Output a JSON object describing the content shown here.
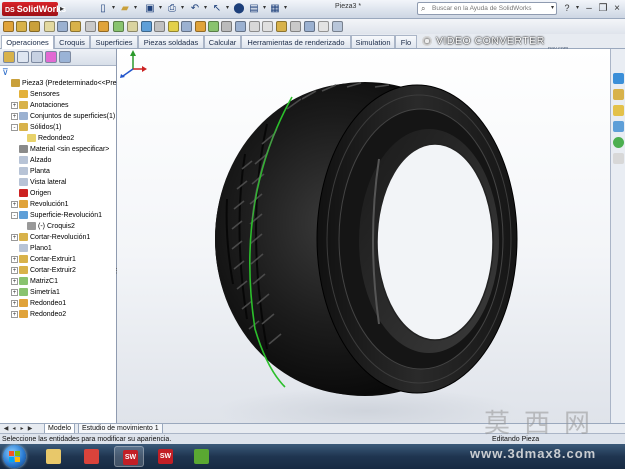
{
  "app": {
    "name": "SolidWorks",
    "doc_title": "Pieza3 *",
    "search_placeholder": "Buscar en la Ayuda de SolidWorks"
  },
  "tabs": [
    {
      "label": "Operaciones",
      "active": true
    },
    {
      "label": "Croquis"
    },
    {
      "label": "Superficies"
    },
    {
      "label": "Piezas soldadas"
    },
    {
      "label": "Calcular"
    },
    {
      "label": "Herramientas de renderizado"
    },
    {
      "label": "Simulation"
    },
    {
      "label": "Flo"
    }
  ],
  "watermark_top": {
    "text": "VIDEO CONVERTER",
    "sub": "pay.com"
  },
  "tree": [
    {
      "label": "Pieza3  (Predeterminado<<Pre",
      "indent": 0,
      "icon": "part-icon",
      "exp": ""
    },
    {
      "label": "Sensores",
      "indent": 1,
      "icon": "sensor-icon",
      "exp": ""
    },
    {
      "label": "Anotaciones",
      "indent": 1,
      "icon": "annotations-icon",
      "exp": "+"
    },
    {
      "label": "Conjuntos de superficies(1)",
      "indent": 1,
      "icon": "surface-bodies-icon",
      "exp": "+"
    },
    {
      "label": "Sólidos(1)",
      "indent": 1,
      "icon": "solid-bodies-icon",
      "exp": "-"
    },
    {
      "label": "Redondeo2",
      "indent": 2,
      "icon": "fillet-body-icon",
      "exp": ""
    },
    {
      "label": "Material <sin especificar>",
      "indent": 1,
      "icon": "material-icon",
      "exp": ""
    },
    {
      "label": "Alzado",
      "indent": 1,
      "icon": "plane-icon",
      "exp": ""
    },
    {
      "label": "Planta",
      "indent": 1,
      "icon": "plane-icon",
      "exp": ""
    },
    {
      "label": "Vista lateral",
      "indent": 1,
      "icon": "plane-icon",
      "exp": ""
    },
    {
      "label": "Origen",
      "indent": 1,
      "icon": "origin-icon",
      "exp": ""
    },
    {
      "label": "Revolución1",
      "indent": 1,
      "icon": "revolve-icon",
      "exp": "+"
    },
    {
      "label": "Superficie-Revolución1",
      "indent": 1,
      "icon": "surface-revolve-icon",
      "exp": "-"
    },
    {
      "label": "(-) Croquis2",
      "indent": 2,
      "icon": "sketch-icon",
      "exp": ""
    },
    {
      "label": "Cortar-Revolución1",
      "indent": 1,
      "icon": "cut-revolve-icon",
      "exp": "+"
    },
    {
      "label": "Plano1",
      "indent": 1,
      "icon": "plane-icon",
      "exp": ""
    },
    {
      "label": "Cortar-Extruir1",
      "indent": 1,
      "icon": "cut-extrude-icon",
      "exp": "+"
    },
    {
      "label": "Cortar-Extruir2",
      "indent": 1,
      "icon": "cut-extrude-icon",
      "exp": "+"
    },
    {
      "label": "MatrizC1",
      "indent": 1,
      "icon": "pattern-icon",
      "exp": "+"
    },
    {
      "label": "Simetría1",
      "indent": 1,
      "icon": "mirror-icon",
      "exp": "+"
    },
    {
      "label": "Redondeo1",
      "indent": 1,
      "icon": "fillet-icon",
      "exp": "+"
    },
    {
      "label": "Redondeo2",
      "indent": 1,
      "icon": "fillet-icon",
      "exp": "+"
    }
  ],
  "model_tabs": [
    {
      "label": "Modelo",
      "active": true
    },
    {
      "label": "Estudio de movimiento 1"
    }
  ],
  "status": {
    "message": "Seleccione las entidades para modificar su apariencia.",
    "mode": "Editando Pieza"
  },
  "taskbar": [
    {
      "name": "taskbar-explorer-icon",
      "color": "#e8c86a",
      "label": ""
    },
    {
      "name": "taskbar-chrome-icon",
      "color": "#d9433b",
      "label": ""
    },
    {
      "name": "taskbar-solidworks-icon",
      "color": "#c21f26",
      "label": "SW",
      "active": true
    },
    {
      "name": "taskbar-solidworks2-icon",
      "color": "#c21f26",
      "label": "SW"
    },
    {
      "name": "taskbar-app-icon",
      "color": "#5aa832",
      "label": ""
    }
  ],
  "watermark_bottom": {
    "chars": "莫西网",
    "url": "www.3dmax8.com"
  },
  "colors": {
    "accent_green": "#2bbf2b",
    "tire_dark": "#1a1a1a"
  }
}
